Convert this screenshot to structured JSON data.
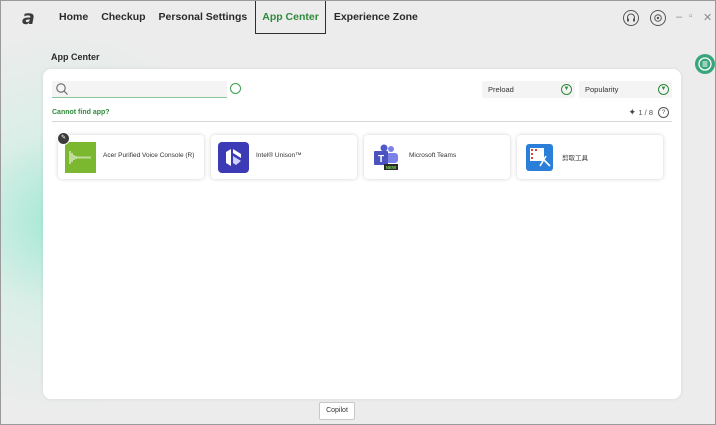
{
  "brand": {
    "logo": "a"
  },
  "nav": {
    "tabs": [
      {
        "label": "Home"
      },
      {
        "label": "Checkup"
      },
      {
        "label": "Personal Settings"
      },
      {
        "label": "App Center"
      },
      {
        "label": "Experience Zone"
      }
    ],
    "active": "App Center"
  },
  "window_controls": [
    "headset-icon",
    "gear-icon",
    "minimize-icon",
    "restore-icon",
    "close-icon"
  ],
  "section_title": "App Center",
  "search": {
    "value": "",
    "placeholder": ""
  },
  "filters": {
    "preload": {
      "selected": "Preload"
    },
    "sort": {
      "selected": "Popularity"
    }
  },
  "cannot_find": "Cannot find app?",
  "pager": {
    "text": "1 / 8"
  },
  "apps": [
    {
      "name": "Acer Purified Voice Console (R)",
      "icon": "voice-wave-icon",
      "color": "#7cb82f",
      "pinned": true
    },
    {
      "name": "Intel® Unison™",
      "icon": "intel-unison-icon",
      "color": "#3c3ab5",
      "pinned": false
    },
    {
      "name": "Microsoft Teams",
      "icon": "teams-icon",
      "color": "#5059c9",
      "pinned": false
    },
    {
      "name": "剪取工具",
      "icon": "snipping-tool-icon",
      "color": "#2b7fd8",
      "pinned": false
    }
  ],
  "copilot_tooltip": "Copilot",
  "colors": {
    "accent": "#2f8a3b",
    "side_button": "#3aa57a"
  }
}
